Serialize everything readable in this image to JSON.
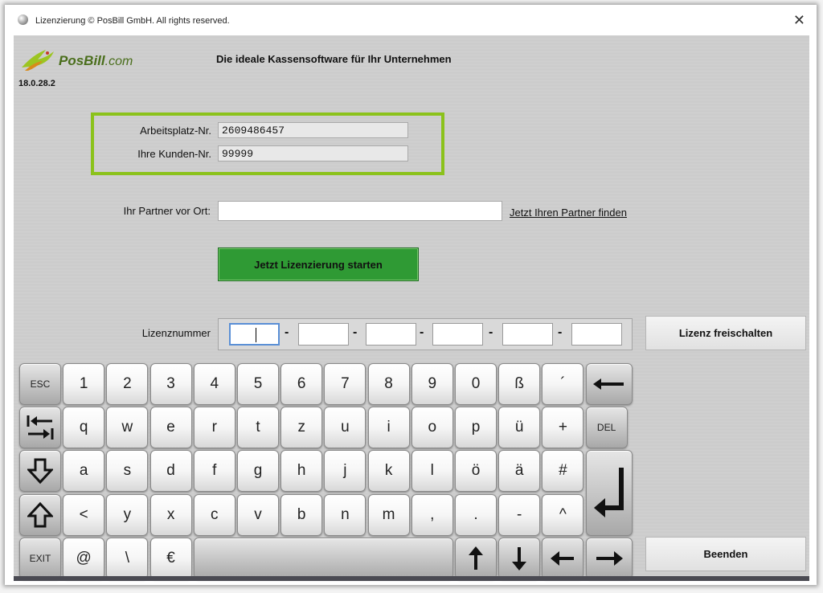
{
  "window": {
    "title": "Lizenzierung © PosBill GmbH. All rights reserved.",
    "close_glyph": "✕"
  },
  "header": {
    "logo_main": "PosBill",
    "logo_suffix": ".com",
    "version": "18.0.28.2",
    "tagline": "Die ideale Kassensoftware für Ihr Unternehmen"
  },
  "form": {
    "workstation_label": "Arbeitsplatz-Nr.",
    "workstation_value": "2609486457",
    "customer_label": "Ihre Kunden-Nr.",
    "customer_value": "99999",
    "partner_label": "Ihr Partner vor Ort:",
    "partner_value": "",
    "partner_link": "Jetzt Ihren Partner finden",
    "start_button": "Jetzt Lizenzierung starten",
    "license_label": "Lizenznummer",
    "license_parts": [
      "",
      "",
      "",
      "",
      "",
      ""
    ],
    "license_separator": "-",
    "unlock_button": "Lizenz freischalten",
    "exit_button": "Beenden"
  },
  "keyboard": {
    "row1": [
      "ESC",
      "1",
      "2",
      "3",
      "4",
      "5",
      "6",
      "7",
      "8",
      "9",
      "0",
      "ß",
      "´"
    ],
    "row2": [
      "q",
      "w",
      "e",
      "r",
      "t",
      "z",
      "u",
      "i",
      "o",
      "p",
      "ü",
      "+",
      "DEL"
    ],
    "row3": [
      "a",
      "s",
      "d",
      "f",
      "g",
      "h",
      "j",
      "k",
      "l",
      "ö",
      "ä",
      "#"
    ],
    "row4": [
      "<",
      "y",
      "x",
      "c",
      "v",
      "b",
      "n",
      "m",
      ",",
      ".",
      "-",
      "^"
    ],
    "row5": [
      "EXIT",
      "@",
      "\\",
      "€"
    ],
    "icons": {
      "backspace": "backspace-arrow-icon",
      "tab": "tab-icon",
      "capslock": "caps-lock-icon",
      "shift": "shift-icon",
      "enter": "enter-icon",
      "up": "arrow-up-icon",
      "down": "arrow-down-icon",
      "left": "arrow-left-icon",
      "right": "arrow-right-icon"
    }
  },
  "colors": {
    "highlight_frame": "#8bc21b",
    "start_button": "#2f9a34",
    "logo_text": "#4a6e1c"
  }
}
